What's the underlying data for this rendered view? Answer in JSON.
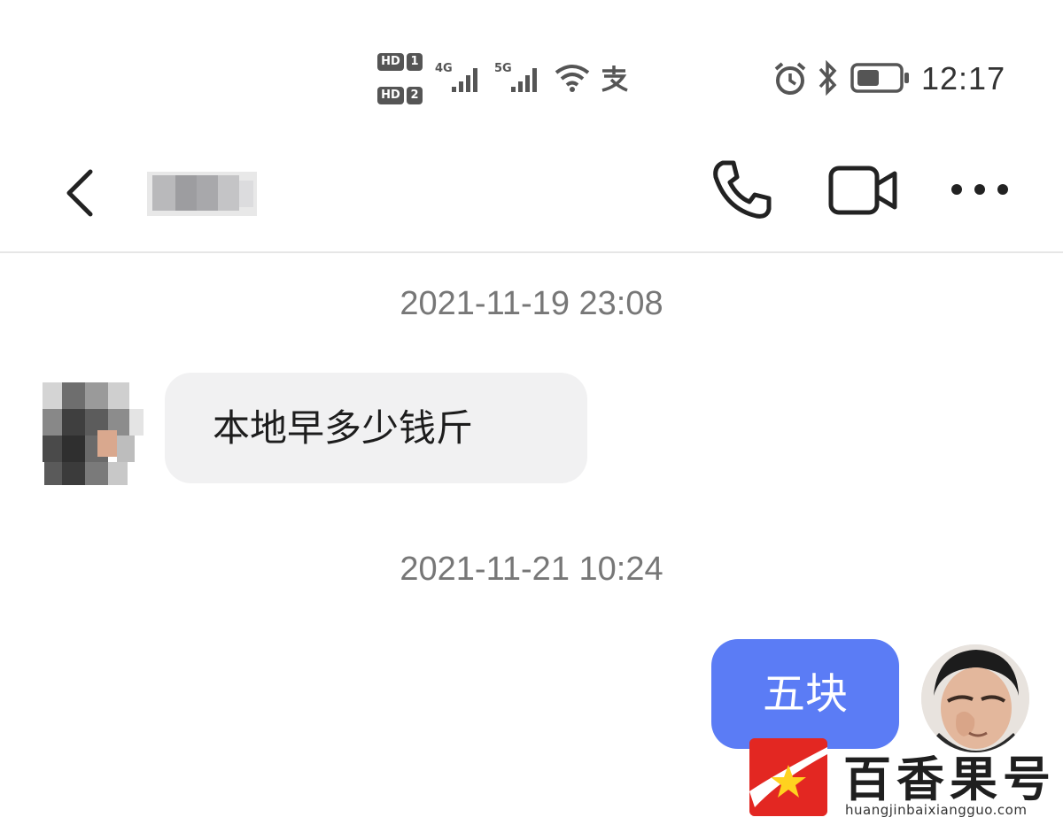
{
  "status_bar": {
    "sim1": {
      "badge": "HD",
      "num": "1"
    },
    "sim2": {
      "badge": "HD",
      "num": "2"
    },
    "network1": "4G",
    "network2": "5G",
    "time": "12:17",
    "icons": [
      "signal-icon",
      "wifi-icon",
      "alipay-icon",
      "alarm-icon",
      "bluetooth-icon",
      "battery-icon"
    ]
  },
  "header": {
    "icons": {
      "back": "chevron-left-icon",
      "call": "phone-icon",
      "video": "video-camera-icon",
      "more": "more-dots-icon"
    }
  },
  "chat": {
    "messages": [
      {
        "timestamp": "2021-11-19 23:08",
        "side": "left",
        "text": "本地早多少钱斤"
      },
      {
        "timestamp": "2021-11-21 10:24",
        "side": "right",
        "text": "五块"
      }
    ]
  },
  "watermark": {
    "title": "百香果号",
    "url": "huangjinbaixiangguo.com"
  },
  "colors": {
    "outgoing_bubble": "#5b7cf5",
    "incoming_bubble": "#f1f1f2",
    "watermark_red": "#e32722"
  }
}
